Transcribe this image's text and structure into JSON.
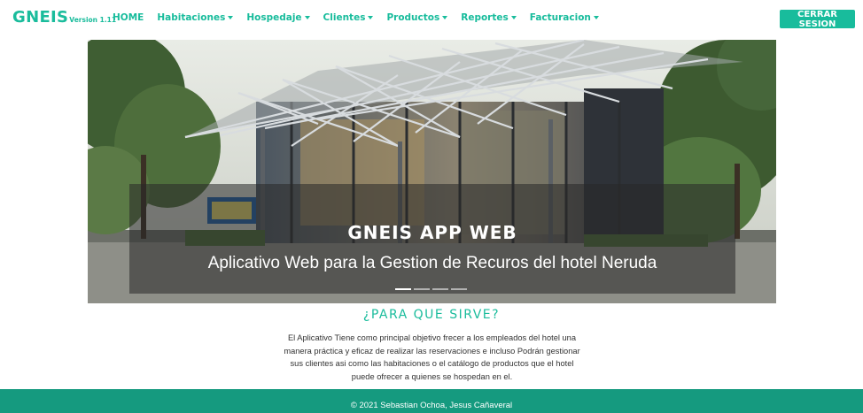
{
  "brand": {
    "name": "GNEIS",
    "version": "Version 1.11"
  },
  "nav": {
    "items": [
      {
        "label": "HOME",
        "dropdown": false
      },
      {
        "label": "Habitaciones",
        "dropdown": true
      },
      {
        "label": "Hospedaje",
        "dropdown": true
      },
      {
        "label": "Clientes",
        "dropdown": true
      },
      {
        "label": "Productos",
        "dropdown": true
      },
      {
        "label": "Reportes",
        "dropdown": true
      },
      {
        "label": "Facturacion",
        "dropdown": true
      }
    ],
    "logout_label": "CERRAR SESION"
  },
  "carousel": {
    "title": "GNEIS APP WEB",
    "subtitle": "Aplicativo Web para la Gestion de Recuros del hotel Neruda",
    "slide_count": 4,
    "active_slide": 1
  },
  "content": {
    "heading": "¿PARA QUE SIRVE?",
    "description": "El Aplicativo Tiene como principal objetivo frecer a los empleados del hotel una manera práctica y eficaz de realizar las reservaciones e incluso Podrán gestionar sus clientes asi como las habitaciones o el catálogo de productos que el hotel puede ofrecer a quienes se hospedan en el."
  },
  "footer": {
    "text": "© 2021 Sebastian Ochoa, Jesus Cañaveral"
  },
  "colors": {
    "accent": "#18bc9c",
    "footer": "#159a7f"
  }
}
